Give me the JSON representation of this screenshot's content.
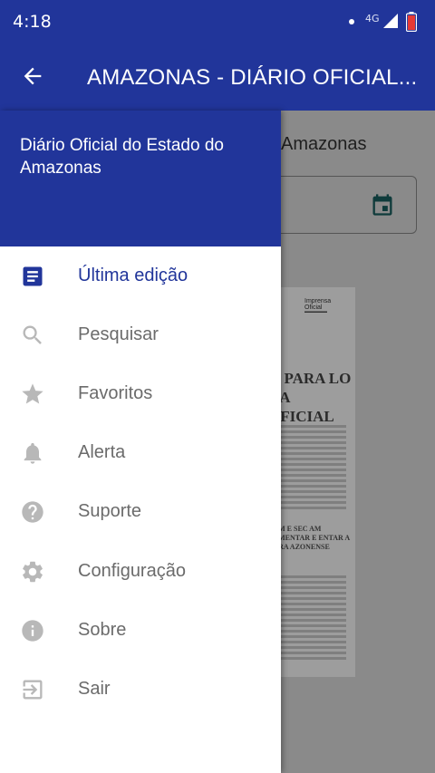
{
  "status_bar": {
    "time": "4:18",
    "network": "4G",
    "icons": [
      "dot-icon",
      "signal-icon",
      "battery-icon"
    ]
  },
  "app_bar": {
    "title": "AMAZONAS - DIÁRIO OFICIAL...",
    "back_icon": "arrow-left-icon"
  },
  "content": {
    "subtitle": "Amazonas",
    "date_icon": "calendar-icon",
    "newspaper": {
      "masthead": "Imprensa Oficial",
      "headline": "O PARA LO DA OFICIAL",
      "section_headline": "EAM E SEC AM FOMENTAR E ENTAR A TURA AZONENSE"
    }
  },
  "drawer": {
    "header_title": "Diário Oficial do Estado do Amazonas",
    "items": [
      {
        "label": "Última edição",
        "icon": "document-icon",
        "active": true
      },
      {
        "label": "Pesquisar",
        "icon": "search-icon",
        "active": false
      },
      {
        "label": "Favoritos",
        "icon": "star-icon",
        "active": false
      },
      {
        "label": "Alerta",
        "icon": "bell-icon",
        "active": false
      },
      {
        "label": "Suporte",
        "icon": "help-icon",
        "active": false
      },
      {
        "label": "Configuração",
        "icon": "gear-icon",
        "active": false
      },
      {
        "label": "Sobre",
        "icon": "info-icon",
        "active": false
      },
      {
        "label": "Sair",
        "icon": "exit-icon",
        "active": false
      }
    ]
  },
  "colors": {
    "primary": "#21359a",
    "icon_inactive": "#b8b8b8",
    "text_inactive": "#6b6b6b",
    "scrim": "#8a8a8a"
  }
}
